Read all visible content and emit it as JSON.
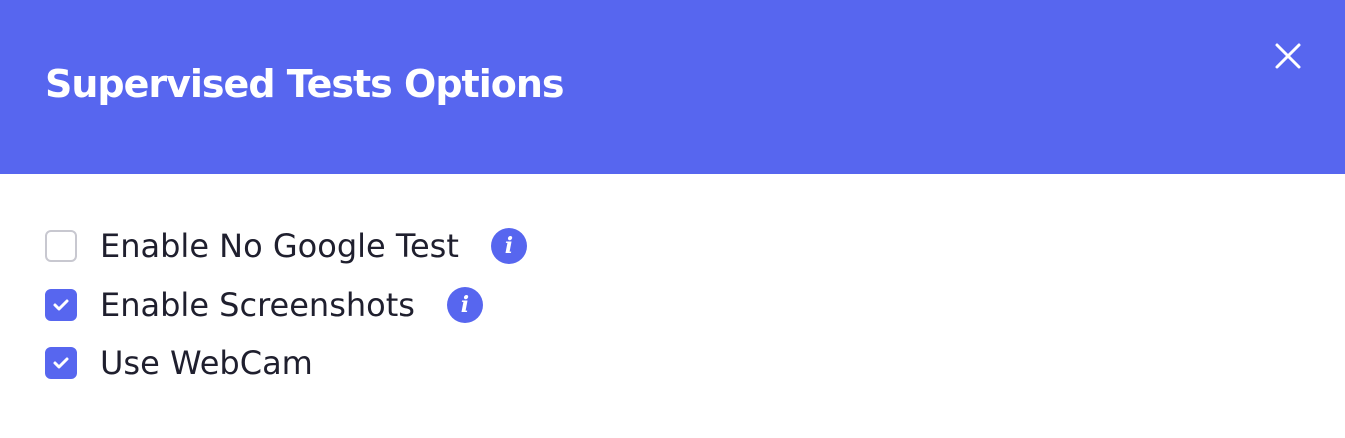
{
  "dialog": {
    "title": "Supervised Tests Options",
    "close_icon": "close-icon"
  },
  "options": [
    {
      "label": "Enable No Google Test",
      "checked": false,
      "has_info": true,
      "info_icon": "info-icon",
      "info_glyph": "i"
    },
    {
      "label": "Enable Screenshots",
      "checked": true,
      "has_info": true,
      "info_icon": "info-icon",
      "info_glyph": "i"
    },
    {
      "label": "Use WebCam",
      "checked": true,
      "has_info": false
    }
  ],
  "colors": {
    "accent": "#5766ef",
    "header_text": "#ffffff",
    "label_text": "#1f1f2e",
    "checkbox_border": "#c8c8d0"
  }
}
